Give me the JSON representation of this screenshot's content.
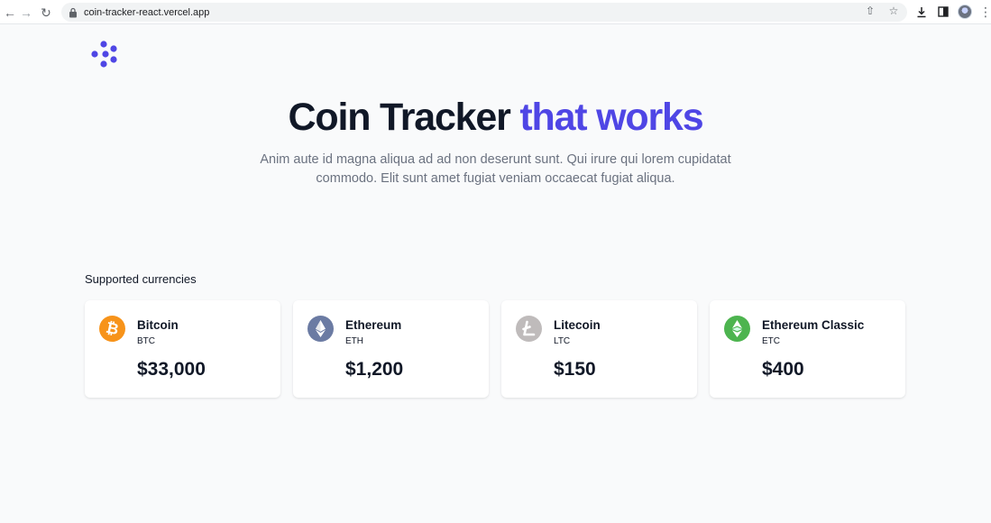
{
  "browser": {
    "url": "coin-tracker-react.vercel.app"
  },
  "hero": {
    "title_main": "Coin Tracker",
    "title_accent": "that works",
    "subtitle": "Anim aute id magna aliqua ad ad non deserunt sunt. Qui irure qui lorem cupidatat commodo. Elit sunt amet fugiat veniam occaecat fugiat aliqua."
  },
  "section": {
    "title": "Supported currencies"
  },
  "currencies": [
    {
      "name": "Bitcoin",
      "symbol": "BTC",
      "price": "$33,000",
      "icon": "bitcoin-icon",
      "color": "#f7931a"
    },
    {
      "name": "Ethereum",
      "symbol": "ETH",
      "price": "$1,200",
      "icon": "ethereum-icon",
      "color": "#627eea"
    },
    {
      "name": "Litecoin",
      "symbol": "LTC",
      "price": "$150",
      "icon": "litecoin-icon",
      "color": "#bfbbbb"
    },
    {
      "name": "Ethereum Classic",
      "symbol": "ETC",
      "price": "$400",
      "icon": "ethereum-classic-icon",
      "color": "#4db44f"
    }
  ],
  "colors": {
    "accent": "#4f46e5",
    "background": "#f9fafb",
    "text": "#111827",
    "muted": "#6b7280"
  }
}
